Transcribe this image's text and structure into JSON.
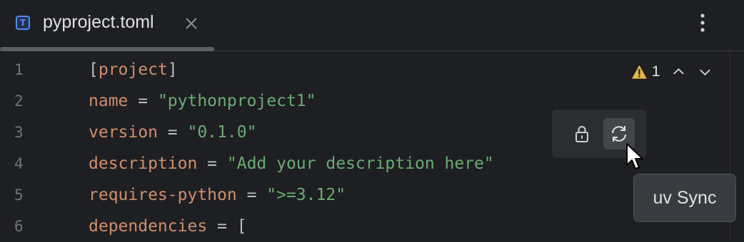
{
  "tab": {
    "file_icon_letter": "T",
    "title": "pyproject.toml"
  },
  "gutter": {
    "lines": [
      "1",
      "2",
      "3",
      "4",
      "5",
      "6"
    ]
  },
  "code": {
    "line1": {
      "open": "[",
      "section": "project",
      "close": "]"
    },
    "line2": {
      "key": "name",
      "op": " = ",
      "value": "\"pythonproject1\""
    },
    "line3": {
      "key": "version",
      "op": " = ",
      "value": "\"0.1.0\""
    },
    "line4": {
      "key": "description",
      "op": " = ",
      "value": "\"Add your description here\""
    },
    "line5": {
      "key": "requires-python",
      "op": " = ",
      "value": "\">=3.12\""
    },
    "line6": {
      "key": "dependencies",
      "op": " = ",
      "value": "["
    }
  },
  "inspections": {
    "warning_count": "1",
    "icon": "warning-triangle-icon",
    "color": "#e5b84a"
  },
  "toolbar": {
    "lock_icon": "lock-icon",
    "sync_icon": "sync-icon"
  },
  "tooltip": {
    "text": "uv Sync"
  },
  "colors": {
    "keyword": "#cf8e6d",
    "string": "#6aab73",
    "background": "#1e1f22",
    "accent": "#548af7"
  }
}
